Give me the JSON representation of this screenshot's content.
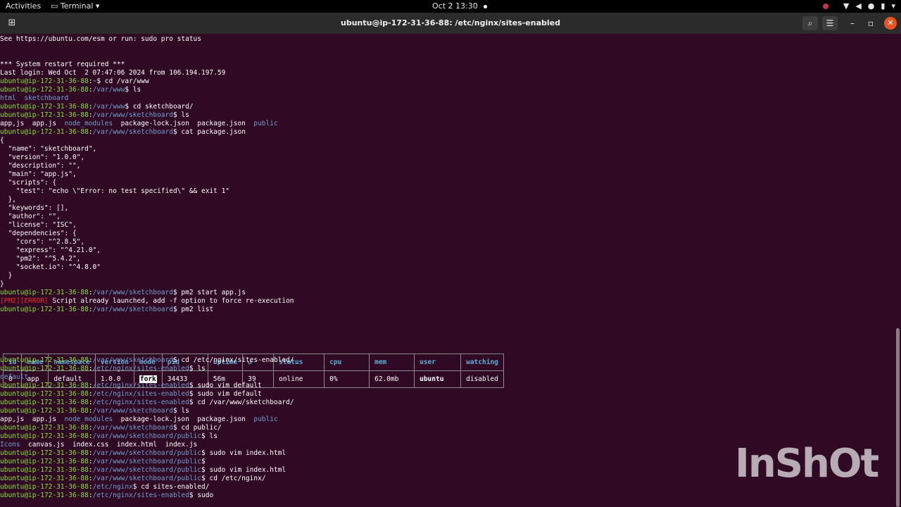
{
  "topbar": {
    "activities": "Activities",
    "app_menu": "Terminal",
    "clock": "Oct 2  13:30",
    "tray_icons": [
      "record-indicator",
      "wifi-icon",
      "volume-icon",
      "microphone-icon",
      "battery-icon",
      "power-menu-icon"
    ]
  },
  "window": {
    "title": "ubuntu@ip-172-31-36-88: /etc/nginx/sites-enabled",
    "buttons": [
      "new-tab",
      "search",
      "menu",
      "minimize",
      "maximize",
      "close"
    ]
  },
  "terminal": {
    "prompt_user": "ubuntu@ip-172-31-36-88",
    "lines": {
      "l0": "See https://ubuntu.com/esm or run: sudo pro status",
      "l1": "*** System restart required ***",
      "l2": "Last login: Wed Oct  2 07:47:06 2024 from 106.194.197.59",
      "p3": "~",
      "c3": "cd /var/www",
      "p4": "/var/www",
      "c4": "ls",
      "o5a": "html",
      "o5b": "sketchboard",
      "p6": "/var/www",
      "c6": "cd sketchboard/",
      "p7": "/var/www/sketchboard",
      "c7": "ls",
      "o8a": "app,js  app.js  ",
      "o8b": "node_modules",
      "o8c": "  package-lock.json  package.json  ",
      "o8d": "public",
      "p9": "/var/www/sketchboard",
      "c9": "cat package.json",
      "j0": "{",
      "j1": "  \"name\": \"sketchboard\",",
      "j2": "  \"version\": \"1.0.0\",",
      "j3": "  \"description\": \"\",",
      "j4": "  \"main\": \"app.js\",",
      "j5": "  \"scripts\": {",
      "j6": "    \"test\": \"echo \\\"Error: no test specified\\\" && exit 1\"",
      "j7": "  },",
      "j8": "  \"keywords\": [],",
      "j9": "  \"author\": \"\",",
      "j10": "  \"license\": \"ISC\",",
      "j11": "  \"dependencies\": {",
      "j12": "    \"cors\": \"^2.8.5\",",
      "j13": "    \"express\": \"^4.21.0\",",
      "j14": "    \"pm2\": \"^5.4.2\",",
      "j15": "    \"socket.io\": \"^4.8.0\"",
      "j16": "  }",
      "j17": "}",
      "p10": "/var/www/sketchboard",
      "c10": "pm2 start app.js",
      "e11a": "[PM2][ERROR]",
      "e11b": " Script already launched, add -f option to force re-execution",
      "p12": "/var/www/sketchboard",
      "c12": "pm2 list",
      "p13": "/var/www/sketchboard",
      "c13": "cd /etc/nginx/sites-enabled/",
      "p14": "/etc/nginx/sites-enabled",
      "c14": "ls",
      "o15": "default",
      "p16": "/etc/nginx/sites-enabled",
      "c16": "sudo vim default",
      "p17": "/etc/nginx/sites-enabled",
      "c17": "sudo vim default",
      "p18": "/etc/nginx/sites-enabled",
      "c18": "cd /var/www/sketchboard/",
      "p19": "/var/www/sketchboard",
      "c19": "ls",
      "o20a": "app,js  app.js  ",
      "o20b": "node_modules",
      "o20c": "  package-lock.json  package.json  ",
      "o20d": "public",
      "p21": "/var/www/sketchboard",
      "c21": "cd public/",
      "p22": "/var/www/sketchboard/public",
      "c22": "ls",
      "o23a": "Icons",
      "o23b": "  canvas.js  index.css  index.html  index.js",
      "p24": "/var/www/sketchboard/public",
      "c24": "sudo vim index.html",
      "p25": "/var/www/sketchboard/public",
      "c25": "",
      "p26": "/var/www/sketchboard/public",
      "c26": "sudo vim index.html",
      "p27": "/var/www/sketchboard/public",
      "c27": "cd /etc/nginx/",
      "p28": "/etc/nginx",
      "c28": "cd sites-enabled/",
      "p29": "/etc/nginx/sites-enabled",
      "c29": "sudo"
    },
    "pm2": {
      "headers": [
        "id",
        "name",
        "namespace",
        "version",
        "mode",
        "pid",
        "uptime",
        "↺",
        "status",
        "cpu",
        "mem",
        "user",
        "watching"
      ],
      "row": [
        "0",
        "app",
        "default",
        "1.0.0",
        "fork",
        "34433",
        "56m",
        "39",
        "online",
        "0%",
        "62.0mb",
        "ubuntu",
        "disabled"
      ]
    }
  },
  "watermark": "InShOt",
  "colors": {
    "terminal_bg": "#300a24",
    "prompt_user": "#8ae234",
    "prompt_path": "#729fcf",
    "error": "#ef2929",
    "online": "#8ae234"
  }
}
